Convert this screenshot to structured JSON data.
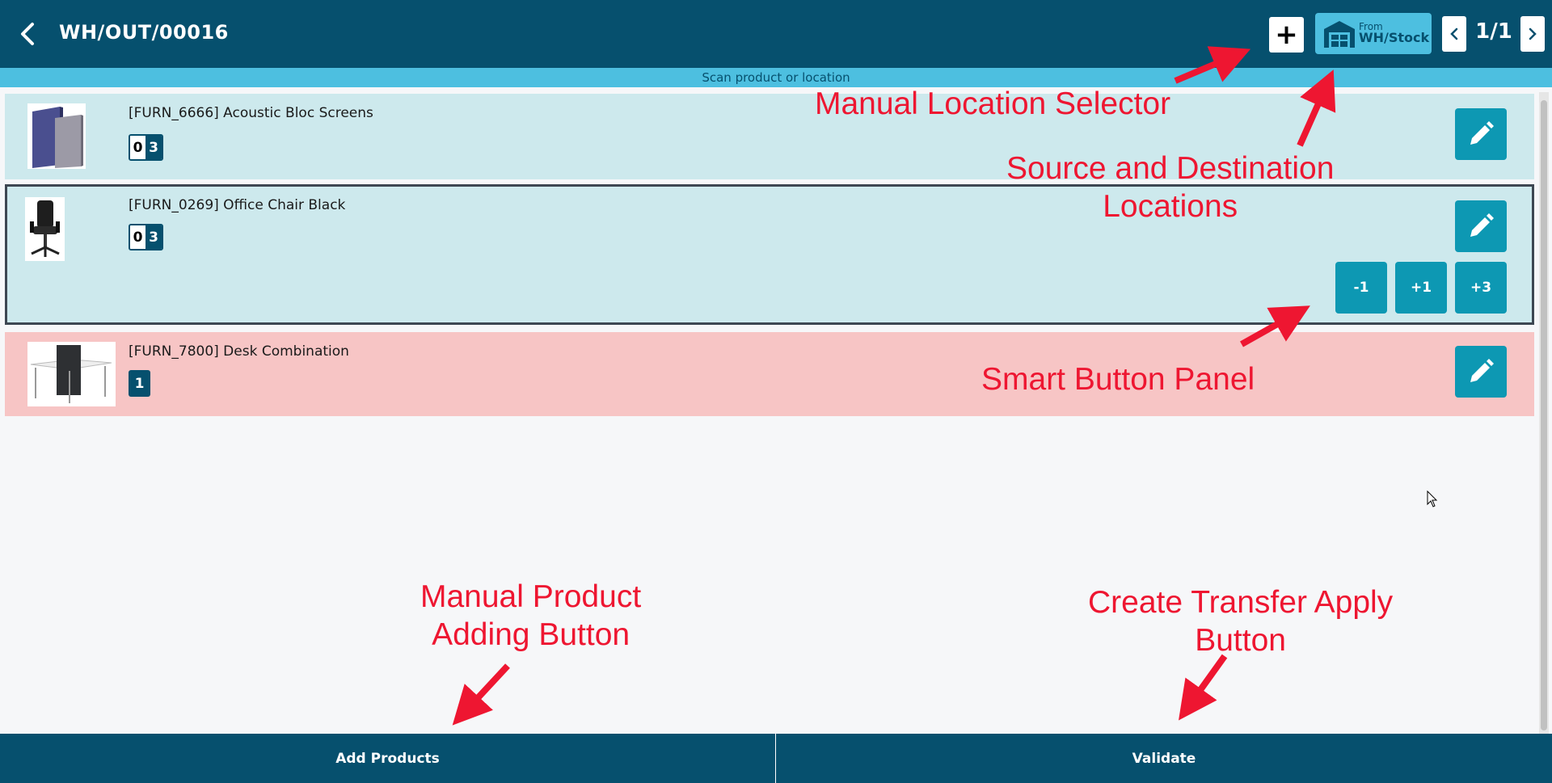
{
  "header": {
    "title": "WH/OUT/00016",
    "add_button": "+",
    "location": {
      "label": "From",
      "name": "WH/Stock"
    },
    "page_counter": "1/1"
  },
  "scan_bar": {
    "text": "Scan product or location"
  },
  "products": [
    {
      "name": "[FURN_6666] Acoustic Bloc Screens",
      "qty_done": "0",
      "qty_total": "3"
    },
    {
      "name": "[FURN_0269] Office Chair Black",
      "qty_done": "0",
      "qty_total": "3",
      "smart_buttons": [
        "-1",
        "+1",
        "+3"
      ]
    },
    {
      "name": "[FURN_7800] Desk Combination",
      "qty": "1"
    }
  ],
  "footer": {
    "add_products": "Add Products",
    "validate": "Validate"
  },
  "annotations": {
    "manual_location": "Manual Location Selector",
    "source_dest_1": "Source and Destination",
    "source_dest_2": "Locations",
    "smart_panel": "Smart Button Panel",
    "manual_product_1": "Manual Product",
    "manual_product_2": "Adding Button",
    "create_transfer_1": "Create Transfer Apply",
    "create_transfer_2": "Button"
  },
  "colors": {
    "primary": "#06506e",
    "accent": "#4dbfe0",
    "button": "#0d98b3",
    "row_default": "#cde9ed",
    "row_incomplete": "#f7c5c5",
    "annotation": "#ee1631"
  },
  "icons": [
    "back-arrow-icon",
    "warehouse-icon",
    "chevron-left-icon",
    "chevron-right-icon",
    "pencil-icon"
  ]
}
